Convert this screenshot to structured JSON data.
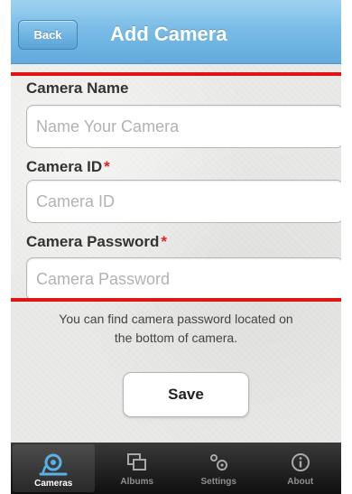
{
  "navbar": {
    "back_label": "Back",
    "title": "Add Camera"
  },
  "form": {
    "camera_name": {
      "label": "Camera Name",
      "placeholder": "Name Your Camera",
      "value": ""
    },
    "camera_id": {
      "label": "Camera ID",
      "required_mark": "*",
      "placeholder": "Camera ID",
      "value": ""
    },
    "camera_password": {
      "label": "Camera Password",
      "required_mark": "*",
      "placeholder": "Camera Password",
      "value": ""
    }
  },
  "note": {
    "line1": "You can find camera password located on",
    "line2": "the bottom of camera."
  },
  "save_label": "Save",
  "tabbar": {
    "active": "Cameras",
    "items": [
      {
        "label": "Cameras",
        "icon": "camera-icon"
      },
      {
        "label": "Albums",
        "icon": "albums-icon"
      },
      {
        "label": "Settings",
        "icon": "gears-icon"
      },
      {
        "label": "About",
        "icon": "info-icon"
      }
    ]
  },
  "colors": {
    "accent": "#6bb3e1",
    "highlight": "#e01414",
    "required": "#e32222",
    "tab_active_icon": "#5ab0e8"
  }
}
